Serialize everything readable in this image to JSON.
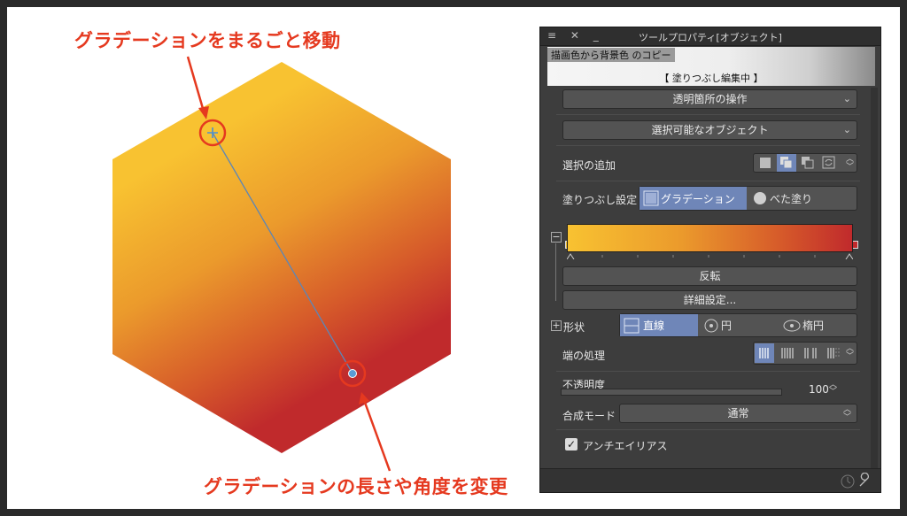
{
  "annotations": {
    "top": "グラデーションをまるごと移動",
    "bottom": "グラデーションの長さや角度を変更"
  },
  "colors": {
    "annotation_red": "#e5391f",
    "gradient_start": "#f8c231",
    "gradient_end": "#c02a2c",
    "active_blue": "#6f86b8"
  },
  "panel": {
    "title": "ツールプロパティ[オブジェクト]",
    "titlebar_icons": "≡ ✕ _",
    "preview_name": "描画色から背景色 のコピー",
    "preview_status": "【 塗りつぶし編集中 】",
    "dropdown_transparent": "透明箇所の操作",
    "dropdown_selectable": "選択可能なオブジェクト",
    "selection_add_label": "選択の追加",
    "fill_setting_label": "塗りつぶし設定",
    "fill_gradient": "グラデーション",
    "fill_solid": "べた塗り",
    "reverse_button": "反転",
    "detail_button": "詳細設定...",
    "shape_label": "形状",
    "shape_line": "直線",
    "shape_circle": "円",
    "shape_ellipse": "楕円",
    "edge_label": "端の処理",
    "opacity_label": "不透明度",
    "opacity_value": "100",
    "blend_label": "合成モード",
    "blend_value": "通常",
    "antialias_label": "アンチエイリアス",
    "antialias_checked": true,
    "plus_icon": "+",
    "minus_icon": "−"
  }
}
